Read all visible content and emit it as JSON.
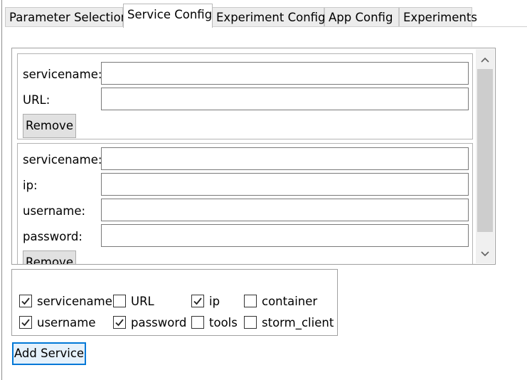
{
  "tabs": [
    {
      "label": "Parameter Selection"
    },
    {
      "label": "Service Config"
    },
    {
      "label": "Experiment Config"
    },
    {
      "label": "App Config"
    },
    {
      "label": "Experiments"
    }
  ],
  "service_groups": [
    {
      "fields": [
        {
          "label": "servicename:",
          "value": ""
        },
        {
          "label": "URL:",
          "value": ""
        }
      ],
      "remove_label": "Remove"
    },
    {
      "fields": [
        {
          "label": "servicename:",
          "value": ""
        },
        {
          "label": "ip:",
          "value": ""
        },
        {
          "label": "username:",
          "value": ""
        },
        {
          "label": "password:",
          "value": ""
        }
      ],
      "remove_label": "Remove"
    }
  ],
  "scrollbar": {
    "up_icon": "chevron-up-icon",
    "down_icon": "chevron-down-icon"
  },
  "field_options": [
    {
      "label": "servicename",
      "checked": true
    },
    {
      "label": "URL",
      "checked": false
    },
    {
      "label": "ip",
      "checked": true
    },
    {
      "label": "container",
      "checked": false
    },
    {
      "label": "username",
      "checked": true
    },
    {
      "label": "password",
      "checked": true
    },
    {
      "label": "tools",
      "checked": false
    },
    {
      "label": "storm_client",
      "checked": false
    }
  ],
  "add_service_label": "Add Service"
}
